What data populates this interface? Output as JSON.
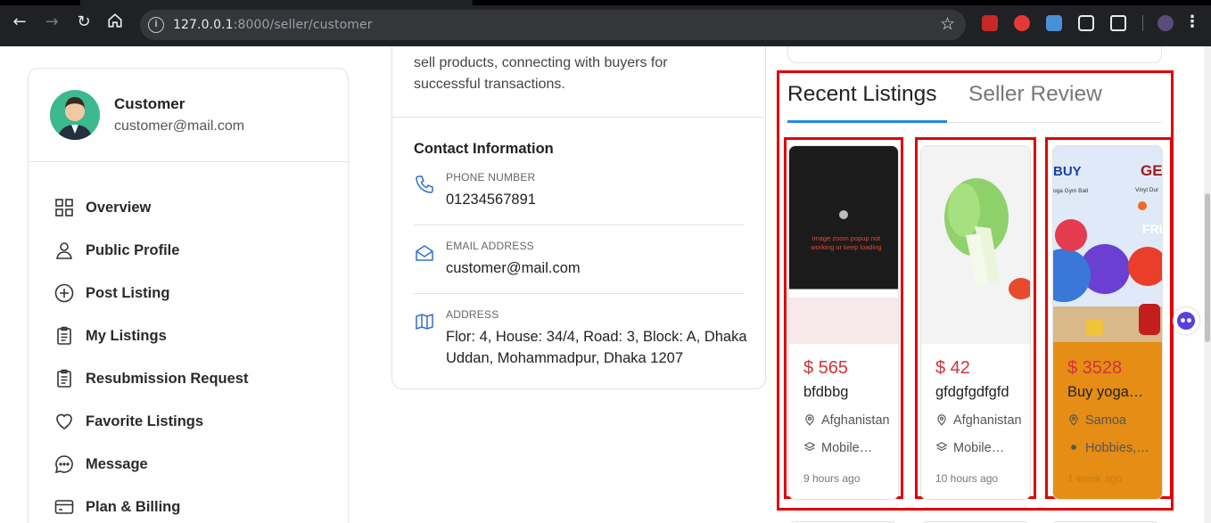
{
  "browser": {
    "url_host": "127.0.0.1",
    "url_rest": ":8000/seller/customer"
  },
  "profile": {
    "name": "Customer",
    "email": "customer@mail.com"
  },
  "sidebar": {
    "items": [
      {
        "label": "Overview",
        "icon": "grid-icon"
      },
      {
        "label": "Public Profile",
        "icon": "user-icon"
      },
      {
        "label": "Post Listing",
        "icon": "plus-circle-icon"
      },
      {
        "label": "My Listings",
        "icon": "clipboard-icon"
      },
      {
        "label": "Resubmission Request",
        "icon": "clipboard-icon"
      },
      {
        "label": "Favorite Listings",
        "icon": "heart-icon"
      },
      {
        "label": "Message",
        "icon": "chat-icon"
      },
      {
        "label": "Plan & Billing",
        "icon": "card-icon"
      }
    ]
  },
  "about": {
    "line1": "sell products, connecting with buyers for",
    "line2": "successful transactions."
  },
  "contact": {
    "title": "Contact Information",
    "phone_label": "PHONE NUMBER",
    "phone": "01234567891",
    "email_label": "EMAIL ADDRESS",
    "email": "customer@mail.com",
    "address_label": "ADDRESS",
    "address": "Flor: 4, House: 34/4, Road: 3, Block: A, Dhaka Uddan, Mohammadpur, Dhaka 1207"
  },
  "tabs": {
    "recent": "Recent Listings",
    "review": "Seller Review"
  },
  "listings": [
    {
      "price": "$ 565",
      "title": "bfdbbg",
      "location": "Afghanistan",
      "category": "Mobile…",
      "time": "9 hours ago",
      "image_text": "image zoom popup not working or keep loading",
      "featured": false
    },
    {
      "price": "$ 42",
      "title": "gfdgfgdfgfd",
      "location": "Afghanistan",
      "category": "Mobile…",
      "time": "10 hours ago",
      "featured": false
    },
    {
      "price": "$ 3528",
      "title": "Buy yoga…",
      "location": "Samoa",
      "category": "Hobbies,…",
      "time": "1 week ago",
      "image_text_left": "BUY",
      "image_text_right": "GE",
      "image_sub_left": "oga Gym Ball",
      "image_sub_right": "Vinyl Dur",
      "image_badge": "FRE",
      "featured": true
    }
  ],
  "colors": {
    "accent": "#1e88e5",
    "price": "#d0333b",
    "highlight_box": "#e00000",
    "featured_bg": "#e58d15"
  }
}
